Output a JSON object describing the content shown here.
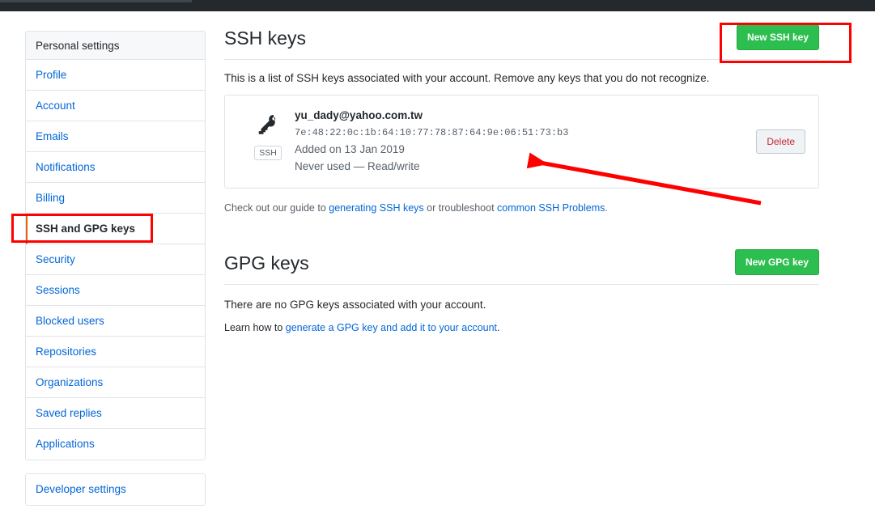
{
  "sidebar": {
    "header": "Personal settings",
    "items": [
      {
        "label": "Profile",
        "selected": false
      },
      {
        "label": "Account",
        "selected": false
      },
      {
        "label": "Emails",
        "selected": false
      },
      {
        "label": "Notifications",
        "selected": false
      },
      {
        "label": "Billing",
        "selected": false
      },
      {
        "label": "SSH and GPG keys",
        "selected": true
      },
      {
        "label": "Security",
        "selected": false
      },
      {
        "label": "Sessions",
        "selected": false
      },
      {
        "label": "Blocked users",
        "selected": false
      },
      {
        "label": "Repositories",
        "selected": false
      },
      {
        "label": "Organizations",
        "selected": false
      },
      {
        "label": "Saved replies",
        "selected": false
      },
      {
        "label": "Applications",
        "selected": false
      }
    ],
    "developer_settings": "Developer settings",
    "selected_accent_color": "#e36209"
  },
  "ssh_section": {
    "title": "SSH keys",
    "new_key_button": "New SSH key",
    "description": "This is a list of SSH keys associated with your account. Remove any keys that you do not recognize.",
    "key": {
      "icon_name": "key-icon",
      "badge": "SSH",
      "title": "yu_dady@yahoo.com.tw",
      "fingerprint": "7e:48:22:0c:1b:64:10:77:78:87:64:9e:06:51:73:b3",
      "added": "Added on 13 Jan 2019",
      "usage": "Never used — Read/write",
      "delete_button": "Delete"
    },
    "footer_note": {
      "prefix": "Check out our guide to ",
      "link1": "generating SSH keys",
      "middle": " or troubleshoot ",
      "link2": "common SSH Problems",
      "suffix": "."
    }
  },
  "gpg_section": {
    "title": "GPG keys",
    "new_key_button": "New GPG key",
    "empty_message": "There are no GPG keys associated with your account.",
    "learn": {
      "prefix": "Learn how to ",
      "link": "generate a GPG key and add it to your account",
      "suffix": "."
    }
  },
  "annotations": {
    "color": "#ff0000",
    "boxes": [
      {
        "name": "new-ssh-key-highlight"
      },
      {
        "name": "sidebar-ssh-gpg-highlight"
      }
    ],
    "arrow": {
      "name": "pointer-arrow",
      "from": "940,251",
      "to": "650,198"
    }
  },
  "colors": {
    "green_button": "#2cbe4e",
    "link": "#0366d6",
    "delete_text": "#cb2431",
    "topbar": "#24292e"
  }
}
